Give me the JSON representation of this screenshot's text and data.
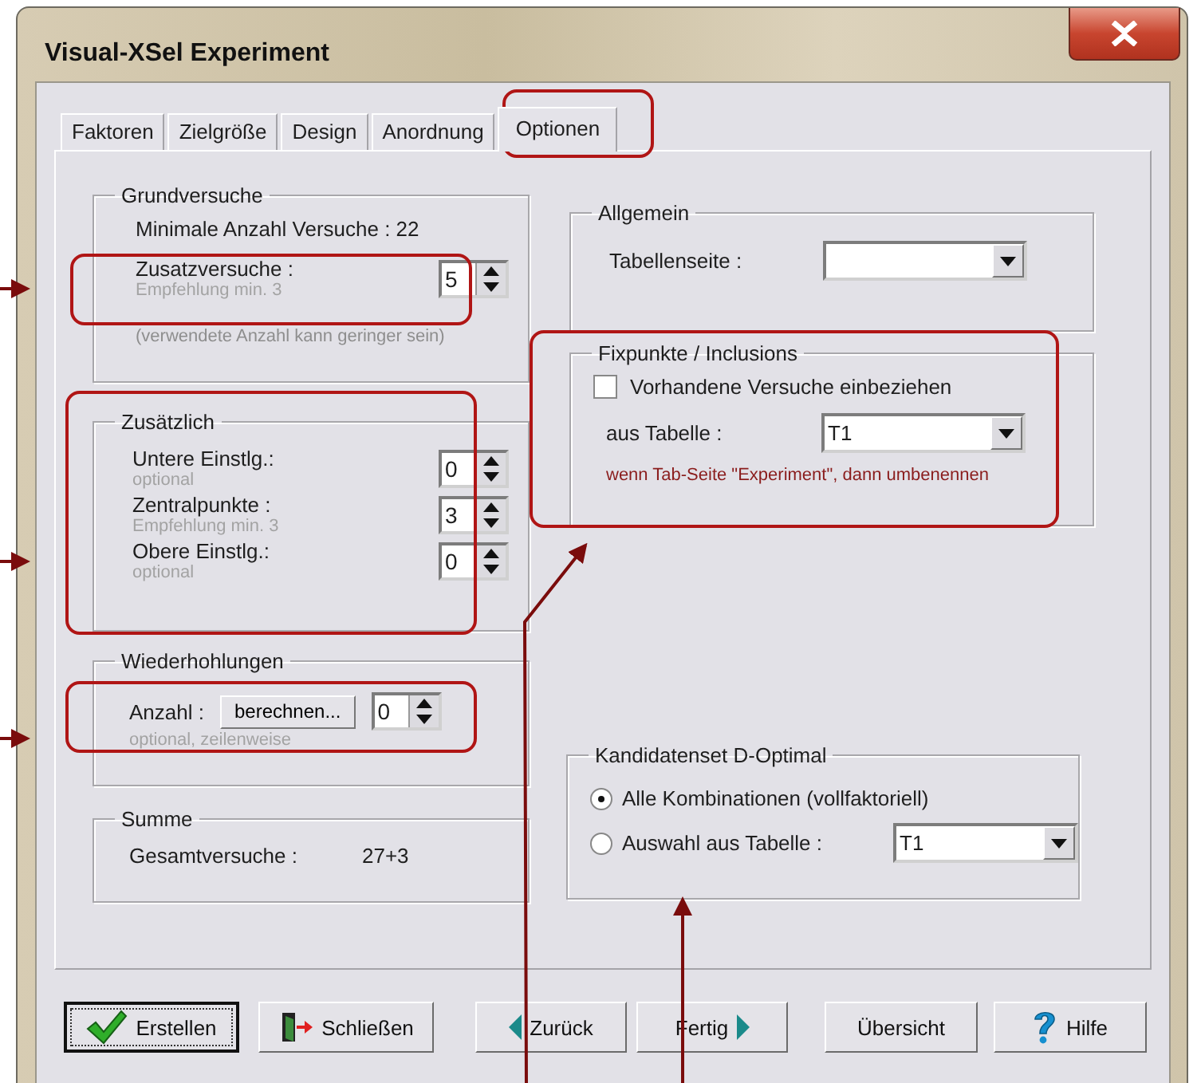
{
  "window": {
    "title": "Visual-XSel  Experiment"
  },
  "tabs": [
    {
      "label": "Faktoren",
      "selected": false
    },
    {
      "label": "Zielgröße",
      "selected": false
    },
    {
      "label": "Design",
      "selected": false
    },
    {
      "label": "Anordnung",
      "selected": false
    },
    {
      "label": "Optionen",
      "selected": true
    }
  ],
  "grundversuche": {
    "title": "Grundversuche",
    "minimum": "Minimale Anzahl Versuche : 22",
    "zusatz": {
      "label": "Zusatzversuche :",
      "hint": "Empfehlung min. 3",
      "value": "5"
    },
    "note": "(verwendete Anzahl kann geringer sein)"
  },
  "zusaetzlich": {
    "title": "Zusätzlich",
    "rows": [
      {
        "label": "Untere Einstlg.:",
        "hint": "optional",
        "value": "0"
      },
      {
        "label": "Zentralpunkte :",
        "hint": "Empfehlung min. 3",
        "value": "3"
      },
      {
        "label": "Obere Einstlg.:",
        "hint": "optional",
        "value": "0"
      }
    ]
  },
  "wiederholungen": {
    "title": "Wiederhohlungen",
    "label": "Anzahl :",
    "button": "berechnen...",
    "value": "0",
    "hint": "optional, zeilenweise"
  },
  "summe": {
    "title": "Summe",
    "label": "Gesamtversuche :",
    "value": "27+3"
  },
  "allgemein": {
    "title": "Allgemein",
    "label": "Tabellenseite :"
  },
  "fixpunkte": {
    "title": "Fixpunkte / Inclusions",
    "checkbox": {
      "label": "Vorhandene Versuche einbeziehen",
      "checked": false
    },
    "label": "aus Tabelle :",
    "value": "T1",
    "note": "wenn Tab-Seite \"Experiment\", dann umbenennen"
  },
  "kandidatenset": {
    "title": "Kandidatenset D-Optimal",
    "options": [
      {
        "label": "Alle Kombinationen (vollfaktoriell)",
        "selected": true
      },
      {
        "label": "Auswahl aus Tabelle :",
        "selected": false,
        "value": "T1"
      }
    ]
  },
  "buttons": [
    {
      "label": "Erstellen",
      "kind": "check",
      "default": true
    },
    {
      "label": "Schließen",
      "kind": "exit",
      "default": false
    },
    {
      "label": "Zurück",
      "kind": "back",
      "default": false
    },
    {
      "label": "Fertig",
      "kind": "forward",
      "default": false
    },
    {
      "label": "Übersicht",
      "kind": "plain",
      "default": false
    },
    {
      "label": "Hilfe",
      "kind": "help",
      "default": false
    }
  ]
}
